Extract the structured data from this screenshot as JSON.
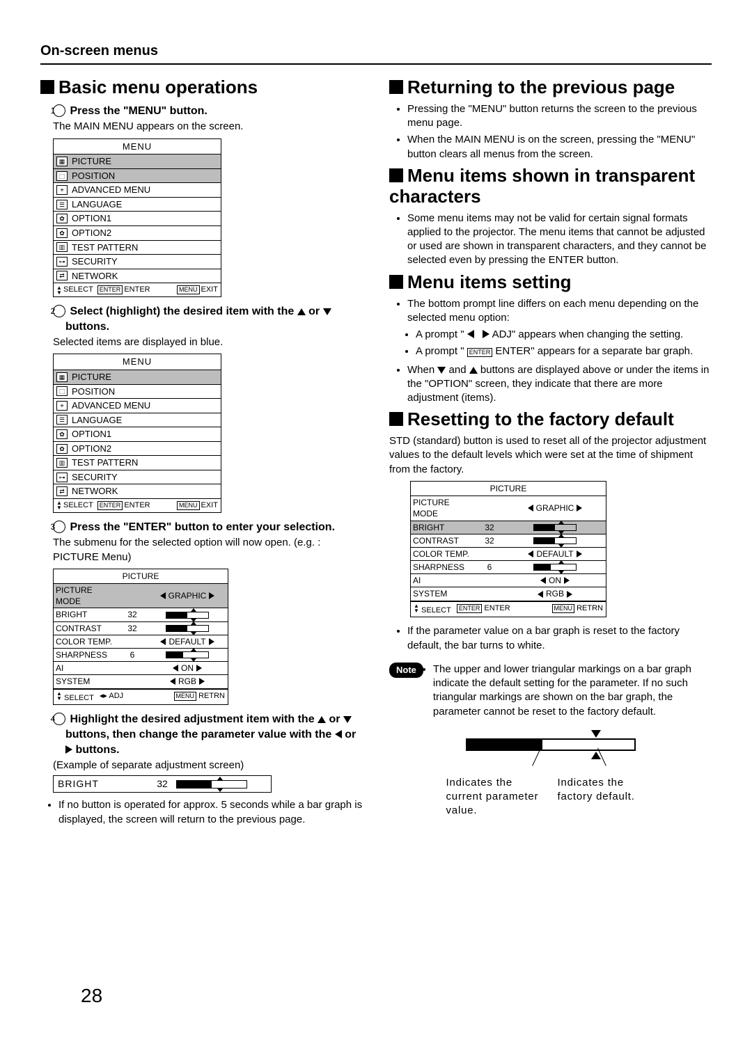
{
  "section_title": "On-screen menus",
  "page_number": "28",
  "left": {
    "h1": "Basic menu operations",
    "step1": {
      "num": "1",
      "title": "Press the \"MENU\" button.",
      "desc": "The MAIN MENU appears on the screen."
    },
    "step2": {
      "num": "2",
      "title_pre": "Select (highlight) the desired item with the ",
      "title_mid": " or ",
      "title_post": " buttons.",
      "desc": "Selected items are displayed in blue."
    },
    "step3": {
      "num": "3",
      "title": "Press the \"ENTER\" button to enter your selection.",
      "desc": "The submenu for the selected option will now open. (e.g. : PICTURE Menu)"
    },
    "step4": {
      "num": "4",
      "title_a": "Highlight the desired adjustment item with the ",
      "title_b": " or ",
      "title_c": " buttons, then change the parameter value with the ",
      "title_d": " or ",
      "title_e": " buttons.",
      "desc": "(Example of separate adjustment screen)",
      "bullet": "If no button is operated for approx. 5 seconds while a bar graph is displayed, the screen will return to the previous page."
    },
    "menu": {
      "title": "MENU",
      "items": [
        "PICTURE",
        "POSITION",
        "ADVANCED MENU",
        "LANGUAGE",
        "OPTION1",
        "OPTION2",
        "TEST PATTERN",
        "SECURITY",
        "NETWORK"
      ],
      "footer_select": "SELECT",
      "footer_enter_box": "ENTER",
      "footer_enter": "ENTER",
      "footer_menu_box": "MENU",
      "footer_exit": "EXIT"
    },
    "picture_menu": {
      "title": "PICTURE",
      "rows": [
        {
          "label": "PICTURE MODE",
          "value": "GRAPHIC",
          "type": "lr",
          "hl": true
        },
        {
          "label": "BRIGHT",
          "value": "32",
          "type": "bar",
          "fill": 50
        },
        {
          "label": "CONTRAST",
          "value": "32",
          "type": "bar",
          "fill": 50
        },
        {
          "label": "COLOR TEMP.",
          "value": "DEFAULT",
          "type": "lr"
        },
        {
          "label": "SHARPNESS",
          "value": "6",
          "type": "bar",
          "fill": 40
        },
        {
          "label": "AI",
          "value": "ON",
          "type": "lr"
        },
        {
          "label": "SYSTEM",
          "value": "RGB",
          "type": "lr"
        }
      ],
      "footer_select": "SELECT",
      "footer_adj": "ADJ",
      "footer_menu_box": "MENU",
      "footer_retrn": "RETRN"
    },
    "bright_row": {
      "label": "BRIGHT",
      "value": "32",
      "fill": 50
    }
  },
  "right": {
    "h1": "Returning to the previous page",
    "h1_bullets": [
      "Pressing the \"MENU\" button returns the screen to the previous menu page.",
      "When the MAIN MENU is on the screen, pressing the \"MENU\" button clears all menus from the screen."
    ],
    "h2": "Menu items shown in transparent characters",
    "h2_bullets": [
      "Some menu items may not be valid for certain signal formats applied to the projector. The menu items that cannot be adjusted or used are shown in transparent characters, and they cannot be selected even by pressing the ENTER button."
    ],
    "h3": "Menu items setting",
    "h3_bullets": {
      "b1": "The bottom prompt line differs on each menu depending on the selected menu option:",
      "b1a_pre": "A prompt \" ",
      "b1a_post": " ADJ\" appears when changing the setting.",
      "b1b_pre": "A prompt \" ",
      "b1b_box": "ENTER",
      "b1b_post": " ENTER\" appears for a separate bar graph.",
      "b2_pre": "When ",
      "b2_mid": " and ",
      "b2_post": " buttons are displayed above or under the items in the \"OPTION\" screen, they indicate that there are more adjustment (items)."
    },
    "h4": "Resetting to the factory default",
    "h4_text": "STD (standard) button is used to reset all of the projector adjustment values to the default levels which were set at the time of shipment from the factory.",
    "picture_menu_r": {
      "title": "PICTURE",
      "rows": [
        {
          "label": "PICTURE MODE",
          "value": "GRAPHIC",
          "type": "lr"
        },
        {
          "label": "BRIGHT",
          "value": "32",
          "type": "bar",
          "fill": 50,
          "hl": true
        },
        {
          "label": "CONTRAST",
          "value": "32",
          "type": "bar",
          "fill": 50
        },
        {
          "label": "COLOR TEMP.",
          "value": "DEFAULT",
          "type": "lr"
        },
        {
          "label": "SHARPNESS",
          "value": "6",
          "type": "bar",
          "fill": 40
        },
        {
          "label": "AI",
          "value": "ON",
          "type": "lr"
        },
        {
          "label": "SYSTEM",
          "value": "RGB",
          "type": "lr"
        }
      ],
      "footer_select": "SELECT",
      "footer_enter_box": "ENTER",
      "footer_enter": "ENTER",
      "footer_menu_box": "MENU",
      "footer_retrn": "RETRN"
    },
    "h4_bullet": "If the parameter value on a bar graph is reset to the factory default, the bar turns to white.",
    "note_label": "Note",
    "note_text": "The upper and lower triangular markings on a bar graph indicate the default setting for the parameter. If no such triangular markings are shown on the bar graph, the parameter cannot be reset to the factory default.",
    "diagram": {
      "left_caption": "Indicates the current parameter value.",
      "right_caption": "Indicates the factory default."
    }
  }
}
